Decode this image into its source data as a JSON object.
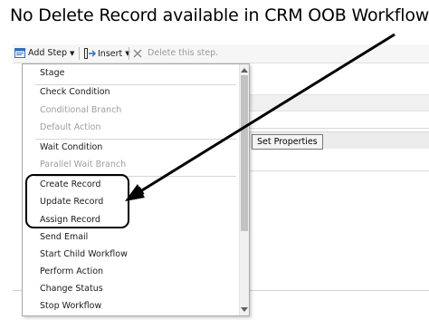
{
  "annotation": {
    "title": "No Delete Record available in CRM OOB Workflow"
  },
  "toolbar": {
    "add_step_label": "Add Step",
    "insert_label": "Insert",
    "delete_label": "Delete this step."
  },
  "designer": {
    "set_properties_label": "Set Properties"
  },
  "menu": {
    "items": [
      {
        "label": "Stage",
        "disabled": false
      },
      {
        "label": "Check Condition",
        "disabled": false
      },
      {
        "label": "Conditional Branch",
        "disabled": true
      },
      {
        "label": "Default Action",
        "disabled": true
      },
      {
        "label": "Wait Condition",
        "disabled": false
      },
      {
        "label": "Parallel Wait Branch",
        "disabled": true
      },
      {
        "label": "Create Record",
        "disabled": false
      },
      {
        "label": "Update Record",
        "disabled": false
      },
      {
        "label": "Assign Record",
        "disabled": false
      },
      {
        "label": "Send Email",
        "disabled": false
      },
      {
        "label": "Start Child Workflow",
        "disabled": false
      },
      {
        "label": "Perform Action",
        "disabled": false
      },
      {
        "label": "Change Status",
        "disabled": false
      },
      {
        "label": "Stop Workflow",
        "disabled": false
      }
    ]
  },
  "colors": {
    "annotation": "#000000",
    "disabled_text": "#9d9d9d",
    "toolbar_icon_blue": "#2f6fb8"
  }
}
